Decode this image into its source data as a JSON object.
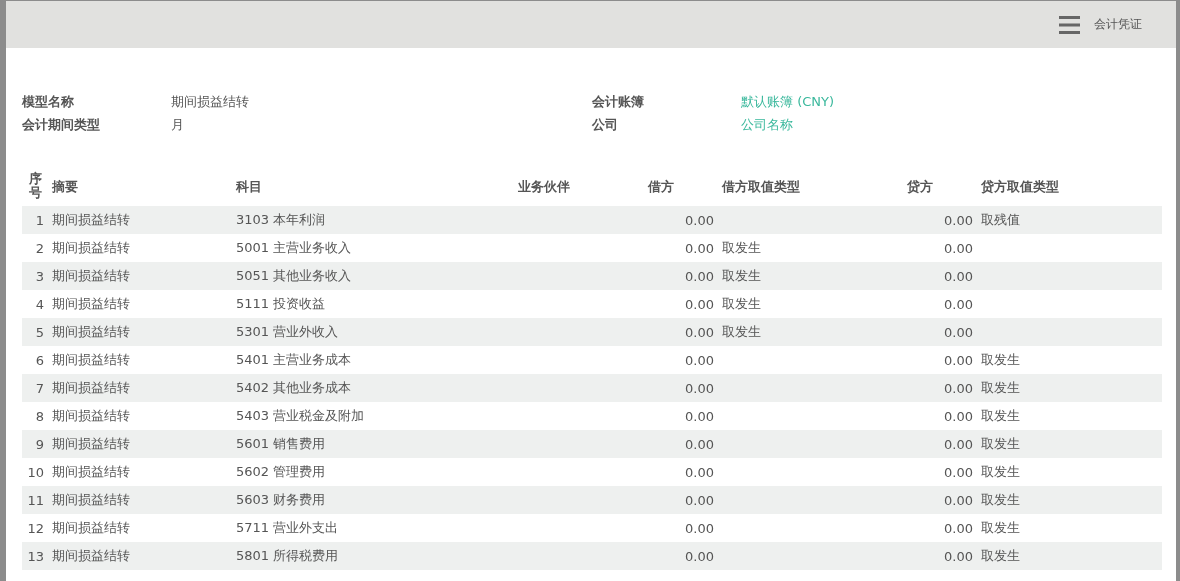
{
  "topbar": {
    "title": "会计凭证"
  },
  "info": [
    {
      "label": "模型名称",
      "value": "期间损益结转",
      "link": false
    },
    {
      "label": "会计账簿",
      "value": "默认账簿 (CNY)",
      "link": true
    },
    {
      "label": "会计期间类型",
      "value": "月",
      "link": false
    },
    {
      "label": "公司",
      "value": "公司名称",
      "link": true
    }
  ],
  "table": {
    "columns": [
      "序号",
      "摘要",
      "科目",
      "业务伙伴",
      "借方",
      "借方取值类型",
      "贷方",
      "贷方取值类型"
    ],
    "rows": [
      {
        "no": "1",
        "summary": "期间损益结转",
        "account": "3103 本年利润",
        "debit": "0.00",
        "debit_type": "",
        "credit": "0.00",
        "credit_type": "取残值"
      },
      {
        "no": "2",
        "summary": "期间损益结转",
        "account": "5001 主营业务收入",
        "debit": "0.00",
        "debit_type": "取发生",
        "credit": "0.00",
        "credit_type": ""
      },
      {
        "no": "3",
        "summary": "期间损益结转",
        "account": "5051 其他业务收入",
        "debit": "0.00",
        "debit_type": "取发生",
        "credit": "0.00",
        "credit_type": ""
      },
      {
        "no": "4",
        "summary": "期间损益结转",
        "account": "5111 投资收益",
        "debit": "0.00",
        "debit_type": "取发生",
        "credit": "0.00",
        "credit_type": ""
      },
      {
        "no": "5",
        "summary": "期间损益结转",
        "account": "5301 营业外收入",
        "debit": "0.00",
        "debit_type": "取发生",
        "credit": "0.00",
        "credit_type": ""
      },
      {
        "no": "6",
        "summary": "期间损益结转",
        "account": "5401 主营业务成本",
        "debit": "0.00",
        "debit_type": "",
        "credit": "0.00",
        "credit_type": "取发生"
      },
      {
        "no": "7",
        "summary": "期间损益结转",
        "account": "5402 其他业务成本",
        "debit": "0.00",
        "debit_type": "",
        "credit": "0.00",
        "credit_type": "取发生"
      },
      {
        "no": "8",
        "summary": "期间损益结转",
        "account": "5403 营业税金及附加",
        "debit": "0.00",
        "debit_type": "",
        "credit": "0.00",
        "credit_type": "取发生"
      },
      {
        "no": "9",
        "summary": "期间损益结转",
        "account": "5601 销售费用",
        "debit": "0.00",
        "debit_type": "",
        "credit": "0.00",
        "credit_type": "取发生"
      },
      {
        "no": "10",
        "summary": "期间损益结转",
        "account": "5602 管理费用",
        "debit": "0.00",
        "debit_type": "",
        "credit": "0.00",
        "credit_type": "取发生"
      },
      {
        "no": "11",
        "summary": "期间损益结转",
        "account": "5603 财务费用",
        "debit": "0.00",
        "debit_type": "",
        "credit": "0.00",
        "credit_type": "取发生"
      },
      {
        "no": "12",
        "summary": "期间损益结转",
        "account": "5711 营业外支出",
        "debit": "0.00",
        "debit_type": "",
        "credit": "0.00",
        "credit_type": "取发生"
      },
      {
        "no": "13",
        "summary": "期间损益结转",
        "account": "5801 所得税费用",
        "debit": "0.00",
        "debit_type": "",
        "credit": "0.00",
        "credit_type": "取发生"
      }
    ]
  }
}
